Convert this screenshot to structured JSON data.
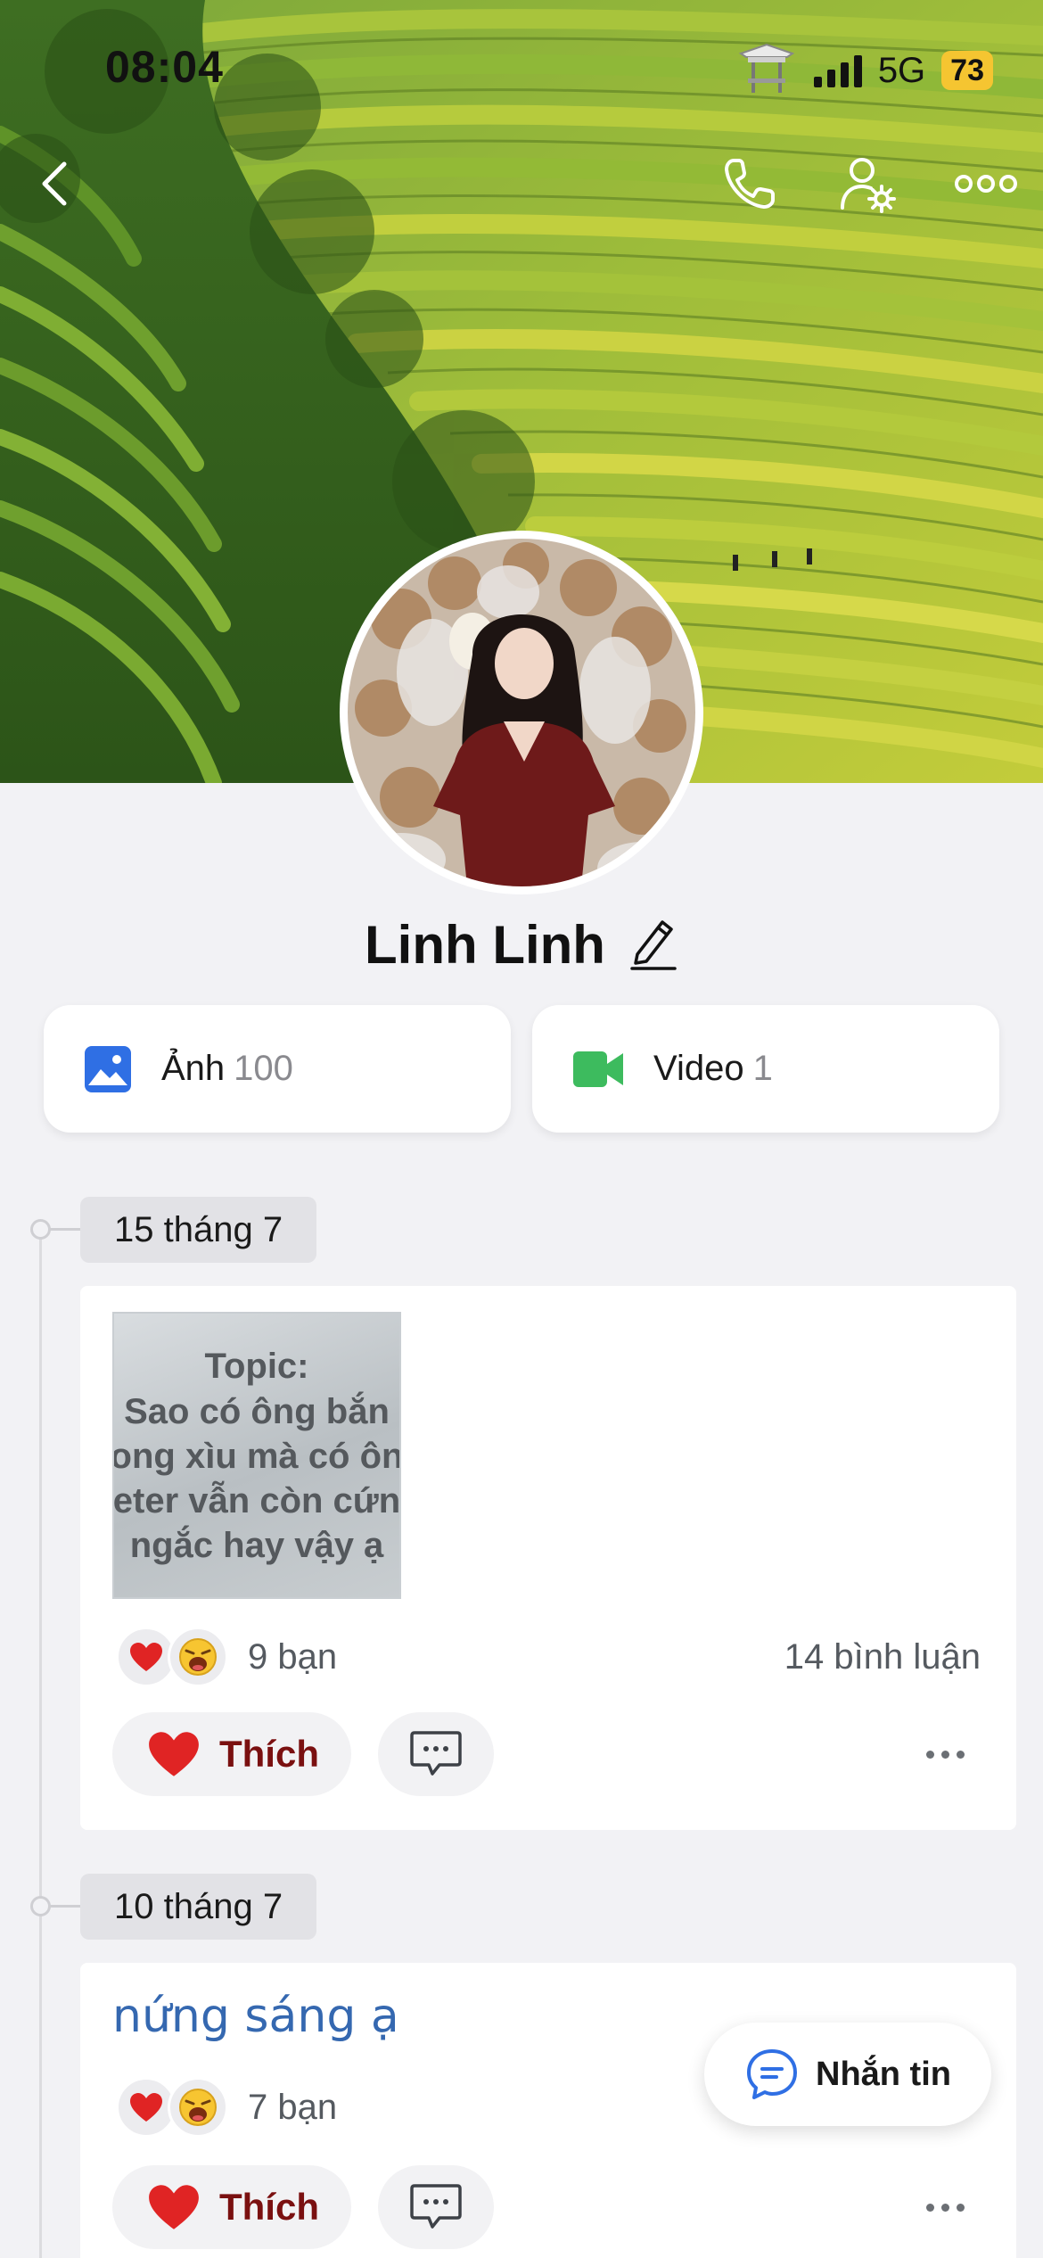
{
  "status_bar": {
    "time": "08:04",
    "network": "5G",
    "battery": "73"
  },
  "header": {
    "back_icon": "chevron-left-icon",
    "call_icon": "phone-icon",
    "profile_settings_icon": "user-gear-icon",
    "more_icon": "more-horizontal-icon"
  },
  "profile": {
    "name": "Linh Linh",
    "edit_icon": "pencil-icon"
  },
  "media": {
    "photos": {
      "label": "Ảnh",
      "count": "100",
      "icon": "image-icon",
      "color": "#2f6fe4"
    },
    "videos": {
      "label": "Video",
      "count": "1",
      "icon": "video-camera-icon",
      "color": "#3dbb5e"
    }
  },
  "timeline": [
    {
      "date": "15 tháng 7",
      "post": {
        "image_text": {
          "topic": "Topic:",
          "lines": [
            "Sao có ông bắn",
            "ong xìu mà có ôn",
            "eter vẫn còn cứn",
            "ngắc hay vậy ạ"
          ]
        },
        "reactions_count": "9 bạn",
        "comments_count": "14 bình luận",
        "like_label": "Thích"
      }
    },
    {
      "date": "10 tháng 7",
      "post": {
        "text": "nứng sáng ạ",
        "reactions_count": "7 bạn",
        "like_label": "Thích"
      }
    }
  ],
  "fab": {
    "label": "Nhắn tin",
    "icon": "chat-bubble-icon",
    "color": "#2f6fe4"
  },
  "colors": {
    "like_text": "#7a1010",
    "heart": "#e02424",
    "accent_blue": "#2f6fe4"
  }
}
